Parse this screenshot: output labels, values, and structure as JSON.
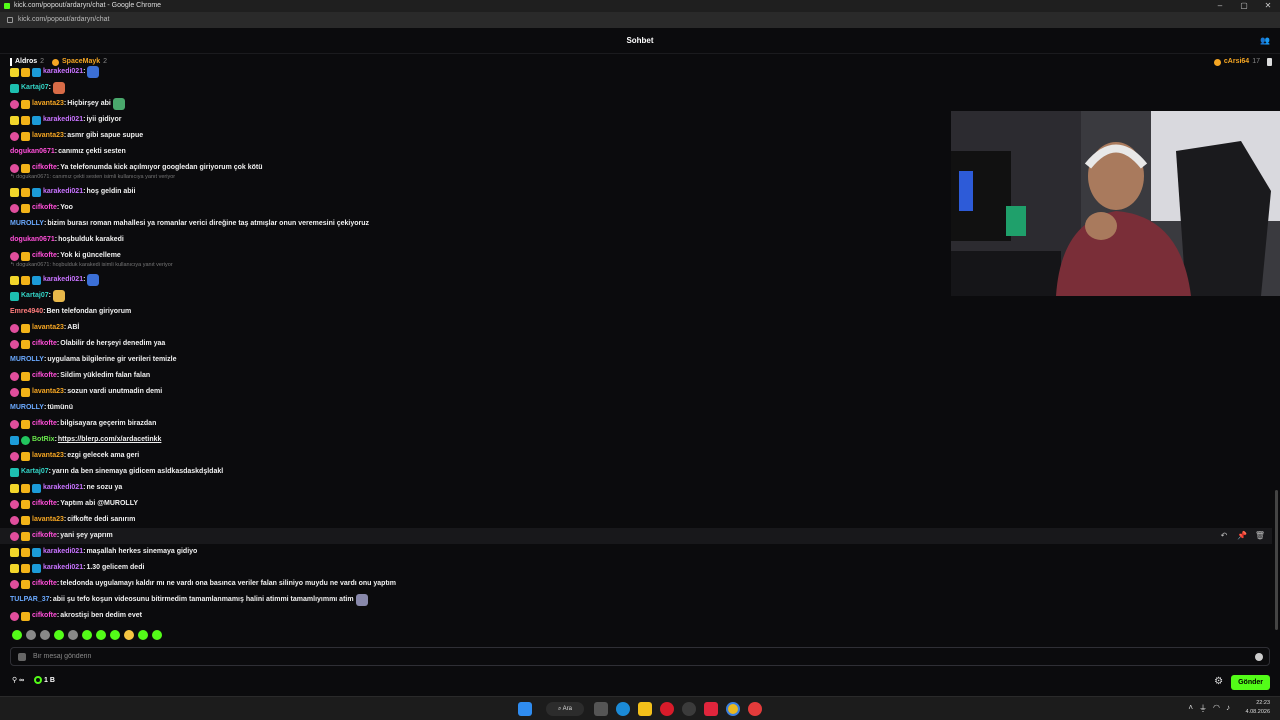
{
  "window": {
    "title": "kick.com/popout/ardaryn/chat - Google Chrome",
    "url": "kick.com/popout/ardaryn/chat",
    "controls": [
      "–",
      "▢",
      "✕"
    ]
  },
  "header": {
    "title": "Sohbet"
  },
  "gifters": [
    {
      "name": "Aldros",
      "count": "2"
    },
    {
      "name": "SpaceMayk",
      "count": "2"
    },
    {
      "name": "cArsi64",
      "count": "17"
    }
  ],
  "colors": {
    "accent": "#53fc18",
    "pink": "#ff4fd8",
    "purple": "#c873ff",
    "blue": "#6aa9ff",
    "cyan": "#33d6c8",
    "salmon": "#ff7c7c",
    "orange": "#f5a623",
    "green": "#69e84c"
  },
  "messages": [
    {
      "badges": [
        "star",
        "crown",
        "vip"
      ],
      "user": "karakedi021",
      "color": "#c873ff",
      "text": "",
      "emote": "#3b6fd6",
      "partial": true
    },
    {
      "badges": [
        "mod"
      ],
      "user": "Kartaj07",
      "color": "#33d6c8",
      "text": "",
      "emote": "#d86b47"
    },
    {
      "badges": [
        "sub",
        "crown"
      ],
      "user": "lavanta23",
      "color": "#f5a623",
      "text": "Hiçbirşey abi",
      "emote": "#4aa86c"
    },
    {
      "badges": [
        "star",
        "crown",
        "vip"
      ],
      "user": "karakedi021",
      "color": "#c873ff",
      "text": "iyii gidiyor"
    },
    {
      "badges": [
        "sub",
        "crown"
      ],
      "user": "lavanta23",
      "color": "#f5a623",
      "text": "asmr gibi sapue supue"
    },
    {
      "badges": [],
      "user": "dogukan0671",
      "color": "#ff4fd8",
      "text": "canımız çekti sesten"
    },
    {
      "badges": [
        "sub",
        "crown"
      ],
      "user": "cifkofte",
      "color": "#ff4fd8",
      "text": "Ya telefonumda kick açılmıyor googledan giriyorum çok kötü"
    },
    {
      "reply": "↰ dogukan0671: canımız çekti sesten isimli kullanıcıya yanıt veriyor"
    },
    {
      "badges": [
        "star",
        "crown",
        "vip"
      ],
      "user": "karakedi021",
      "color": "#c873ff",
      "text": "hoş geldin abii"
    },
    {
      "badges": [
        "sub",
        "crown"
      ],
      "user": "cifkofte",
      "color": "#ff4fd8",
      "text": "Yoo"
    },
    {
      "badges": [],
      "user": "MUROLLY",
      "color": "#6aa9ff",
      "text": "bizim burası roman mahallesi ya romanlar verici direğine taş atmışlar onun veremesini çekiyoruz"
    },
    {
      "badges": [],
      "user": "dogukan0671",
      "color": "#ff4fd8",
      "text": "hoşbulduk karakedi"
    },
    {
      "badges": [
        "sub",
        "crown"
      ],
      "user": "cifkofte",
      "color": "#ff4fd8",
      "text": "Yok ki güncelleme"
    },
    {
      "reply": "↰ dogukan0671: hoşbulduk karakedi isimli kullanıcıya yanıt veriyor"
    },
    {
      "badges": [
        "star",
        "crown",
        "vip"
      ],
      "user": "karakedi021",
      "color": "#c873ff",
      "text": "",
      "emote": "#3b6fd6"
    },
    {
      "badges": [
        "mod"
      ],
      "user": "Kartaj07",
      "color": "#33d6c8",
      "text": "",
      "emote": "#e8b84a"
    },
    {
      "badges": [],
      "user": "Emre4940",
      "color": "#ff7c7c",
      "text": "Ben telefondan giriyorum"
    },
    {
      "badges": [
        "sub",
        "crown"
      ],
      "user": "lavanta23",
      "color": "#f5a623",
      "text": "ABİ"
    },
    {
      "badges": [
        "sub",
        "crown"
      ],
      "user": "cifkofte",
      "color": "#ff4fd8",
      "text": "Olabilir de herşeyi denedim yaa"
    },
    {
      "badges": [],
      "user": "MUROLLY",
      "color": "#6aa9ff",
      "text": "uygulama bilgilerine gir verileri temizle"
    },
    {
      "badges": [
        "sub",
        "crown"
      ],
      "user": "cifkofte",
      "color": "#ff4fd8",
      "text": "Sildim yükledim falan falan"
    },
    {
      "badges": [
        "sub",
        "crown"
      ],
      "user": "lavanta23",
      "color": "#f5a623",
      "text": "sozun vardi unutmadin demi"
    },
    {
      "badges": [],
      "user": "MUROLLY",
      "color": "#6aa9ff",
      "text": "tümünü"
    },
    {
      "badges": [
        "sub",
        "crown"
      ],
      "user": "cifkofte",
      "color": "#ff4fd8",
      "text": "bilgisayara geçerim birazdan"
    },
    {
      "badges": [
        "vip",
        "og"
      ],
      "user": "BotRix",
      "color": "#69e84c",
      "text": "https://blerp.com/x/ardacetinkk",
      "link": true
    },
    {
      "badges": [
        "sub",
        "crown"
      ],
      "user": "lavanta23",
      "color": "#f5a623",
      "text": "ezgi gelecek ama geri"
    },
    {
      "badges": [
        "mod"
      ],
      "user": "Kartaj07",
      "color": "#33d6c8",
      "text": "yarın da ben sinemaya gidicem asldkasdaskdşldakl"
    },
    {
      "badges": [
        "star",
        "crown",
        "vip"
      ],
      "user": "karakedi021",
      "color": "#c873ff",
      "text": "ne sozu ya"
    },
    {
      "badges": [
        "sub",
        "crown"
      ],
      "user": "cifkofte",
      "color": "#ff4fd8",
      "text": "Yaptım abi @MUROLLY"
    },
    {
      "badges": [
        "sub",
        "crown"
      ],
      "user": "lavanta23",
      "color": "#f5a623",
      "text": "cifkofte dedi sanırım"
    },
    {
      "badges": [
        "sub",
        "crown"
      ],
      "user": "cifkofte",
      "color": "#ff4fd8",
      "text": "yani şey yaprım",
      "hover": true
    },
    {
      "badges": [
        "star",
        "crown",
        "vip"
      ],
      "user": "karakedi021",
      "color": "#c873ff",
      "text": "maşallah herkes sinemaya gidiyo"
    },
    {
      "badges": [
        "star",
        "crown",
        "vip"
      ],
      "user": "karakedi021",
      "color": "#c873ff",
      "text": "1.30 gelicem dedi"
    },
    {
      "badges": [
        "sub",
        "crown"
      ],
      "user": "cifkofte",
      "color": "#ff4fd8",
      "text": "teledonda uygulamayı kaldır mı ne vardı ona basınca veriler falan siliniyo muydu ne vardı onu yaptım"
    },
    {
      "badges": [],
      "user": "TULPAR_37",
      "color": "#6aa9ff",
      "text": "abii şu tefo koşun videosunu bitirmedim tamamlanmamış halini atimmi tamamlıyımmı atim",
      "emote": "#8888aa"
    },
    {
      "badges": [
        "sub",
        "crown"
      ],
      "user": "cifkofte",
      "color": "#ff4fd8",
      "text": "akrostişi ben dedim evet"
    }
  ],
  "hover_actions": [
    "↶",
    "📌",
    "🗑"
  ],
  "input": {
    "placeholder": "Bir mesaj gönderin",
    "value": ""
  },
  "bottom": {
    "viewers_icon": "∞",
    "points_label": "1 B",
    "send_label": "Gönder"
  },
  "taskbar": {
    "search_label": "Ara",
    "time": "22:23",
    "date": "4.08.2026"
  }
}
